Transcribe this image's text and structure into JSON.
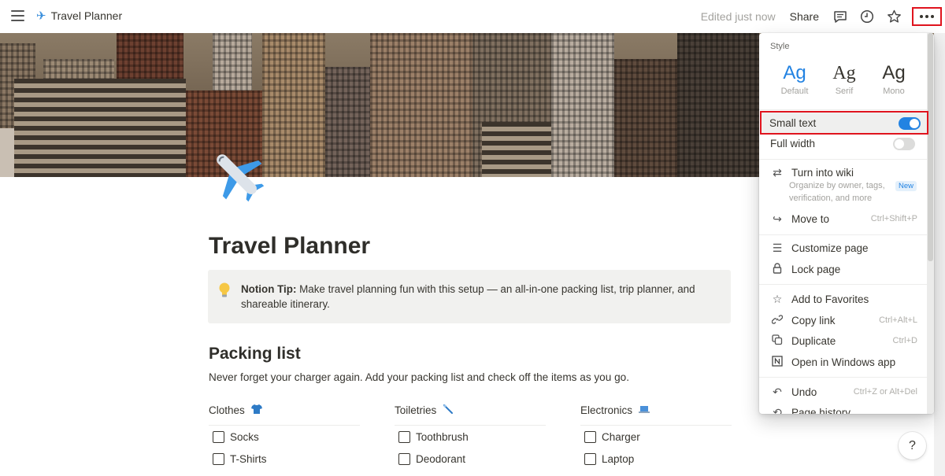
{
  "topbar": {
    "breadcrumb_title": "Travel Planner",
    "edited_status": "Edited just now",
    "share_label": "Share"
  },
  "page": {
    "title": "Travel Planner",
    "callout": {
      "bold": "Notion Tip:",
      "text": " Make travel planning fun with this setup — an all-in-one packing list, trip planner, and shareable itinerary."
    },
    "packing": {
      "heading": "Packing list",
      "description": "Never forget your charger again. Add your packing list and check off the items as you go.",
      "columns": [
        {
          "title": "Clothes",
          "icon": "t-shirt-icon",
          "items": [
            {
              "label": "Socks",
              "checked": false
            },
            {
              "label": "T-Shirts",
              "checked": false
            }
          ]
        },
        {
          "title": "Toiletries",
          "icon": "toothbrush-icon",
          "items": [
            {
              "label": "Toothbrush",
              "checked": false
            },
            {
              "label": "Deodorant",
              "checked": false
            }
          ]
        },
        {
          "title": "Electronics",
          "icon": "laptop-icon",
          "items": [
            {
              "label": "Charger",
              "checked": false
            },
            {
              "label": "Laptop",
              "checked": false
            }
          ]
        }
      ]
    }
  },
  "menu": {
    "style_label": "Style",
    "styles": [
      {
        "glyph": "Ag",
        "name": "Default",
        "selected": true
      },
      {
        "glyph": "Ag",
        "name": "Serif",
        "selected": false
      },
      {
        "glyph": "Ag",
        "name": "Mono",
        "selected": false
      }
    ],
    "small_text": {
      "label": "Small text",
      "on": true
    },
    "full_width": {
      "label": "Full width",
      "on": false
    },
    "turn_into_wiki": {
      "label": "Turn into wiki",
      "sub": "Organize by owner, tags, verification, and more",
      "badge": "New"
    },
    "move_to": {
      "label": "Move to",
      "shortcut": "Ctrl+Shift+P"
    },
    "customize_page": {
      "label": "Customize page"
    },
    "lock_page": {
      "label": "Lock page"
    },
    "add_favorites": {
      "label": "Add to Favorites"
    },
    "copy_link": {
      "label": "Copy link",
      "shortcut": "Ctrl+Alt+L"
    },
    "duplicate": {
      "label": "Duplicate",
      "shortcut": "Ctrl+D"
    },
    "open_windows": {
      "label": "Open in Windows app"
    },
    "undo": {
      "label": "Undo",
      "shortcut": "Ctrl+Z or Alt+Del"
    },
    "page_history": {
      "label": "Page history"
    }
  },
  "help": {
    "label": "?"
  },
  "colors": {
    "accent": "#2383e2",
    "highlight_outline": "#e0141e",
    "callout_bg": "#f1f1ef"
  }
}
